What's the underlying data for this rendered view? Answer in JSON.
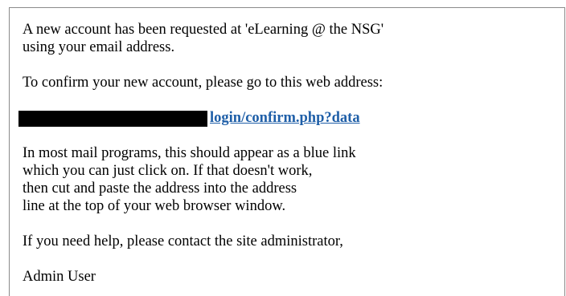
{
  "email": {
    "intro_line_1": "A new account has been requested at 'eLearning @ the NSG'",
    "intro_line_2": "using your email address.",
    "instruction": "To confirm your new account, please go to this web address:",
    "link_text": "login/confirm.php?data",
    "help_line_1": "In most mail programs, this should appear as a blue link",
    "help_line_2": "which you can just click on. If that doesn't work,",
    "help_line_3": "then cut and paste the address into the address",
    "help_line_4": "line at the top of your web browser window.",
    "contact": "If you need help, please contact the site administrator,",
    "signature": "Admin User"
  },
  "colors": {
    "link": "#1f5fa8",
    "text": "#000000",
    "redaction": "#000000",
    "frame_border": "#8a8a8a"
  }
}
